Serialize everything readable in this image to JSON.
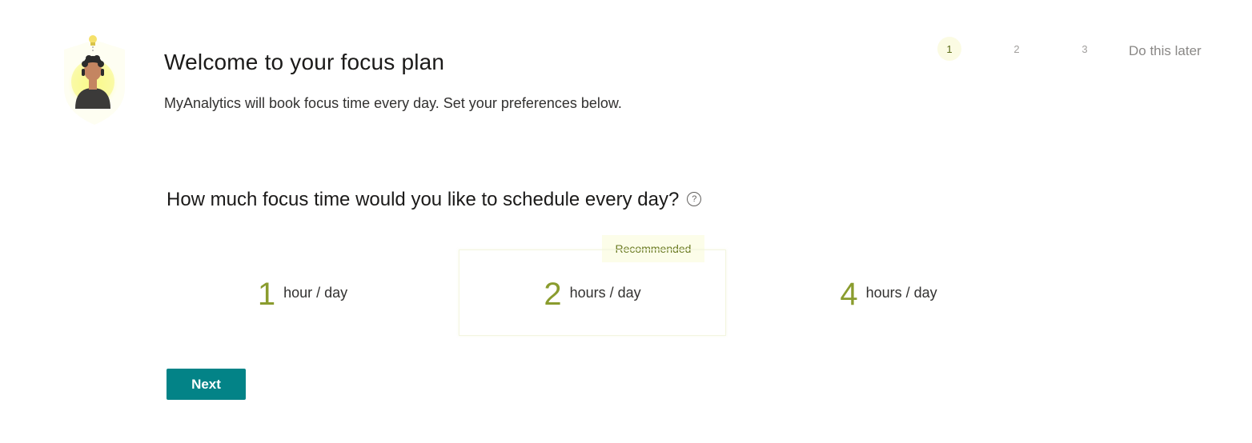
{
  "header": {
    "title": "Welcome to your focus plan",
    "subtitle": "MyAnalytics will book focus time every day. Set your preferences below."
  },
  "stepper": {
    "steps": [
      "1",
      "2",
      "3"
    ],
    "active_step": 1,
    "later_label": "Do this later"
  },
  "question": {
    "text": "How much focus time would you like to schedule every day?",
    "help_glyph": "?"
  },
  "options": [
    {
      "value": "1",
      "unit": "hour / day"
    },
    {
      "value": "2",
      "unit": "hours / day",
      "badge": "Recommended"
    },
    {
      "value": "4",
      "unit": "hours / day"
    }
  ],
  "actions": {
    "next_label": "Next"
  },
  "colors": {
    "accent": "#038387",
    "option_number": "#8a9c2e",
    "recommended_bg": "#fcfde9"
  },
  "icons": {
    "avatar": "person-avatar-with-lightbulb",
    "help": "question-circle-icon"
  }
}
